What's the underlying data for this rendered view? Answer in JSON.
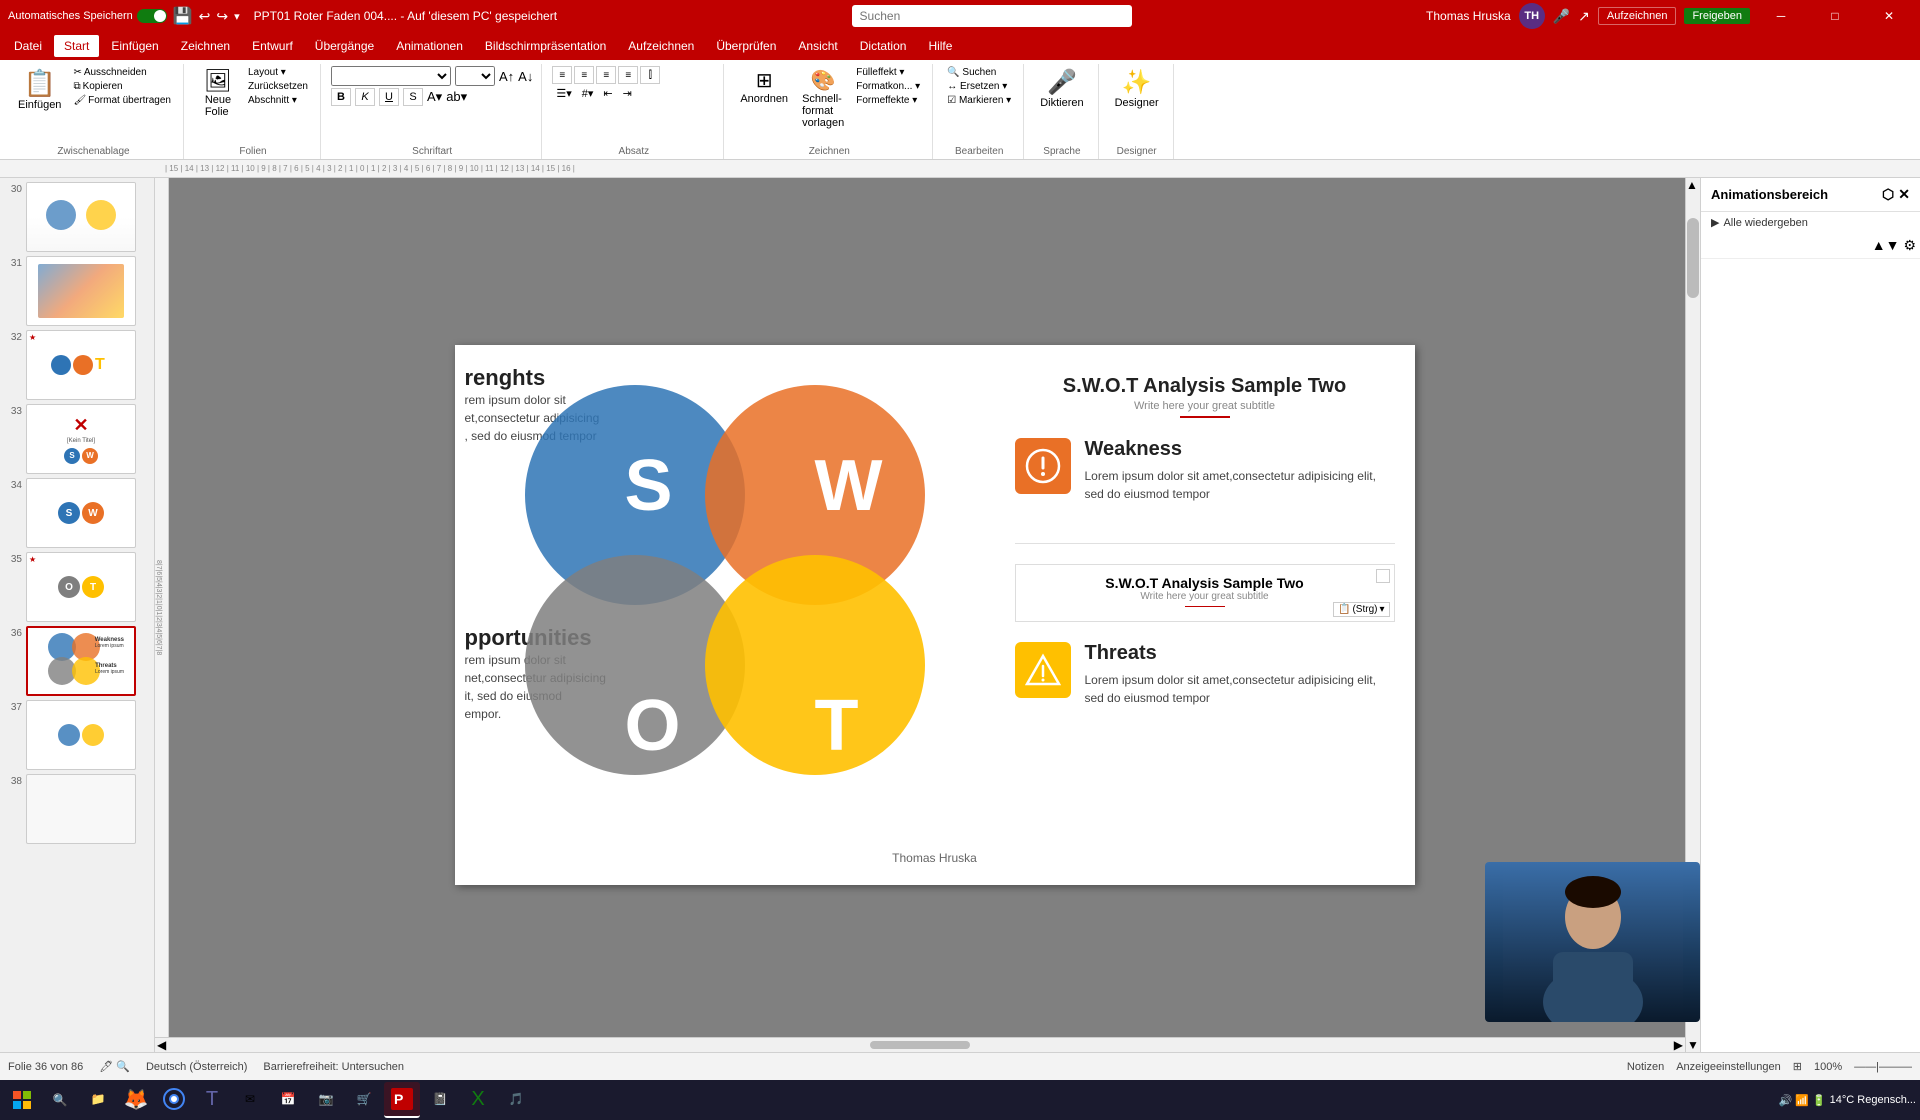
{
  "app": {
    "title": "PPT01 Roter Faden 004.... - Auf 'diesem PC' gespeichert",
    "user": "Thomas Hruska",
    "initials": "TH"
  },
  "titlebar": {
    "autosave_label": "Automatisches Speichern",
    "save_icon": "💾",
    "undo_icon": "↩",
    "redo_icon": "↪",
    "close": "✕",
    "minimize": "─",
    "maximize": "□",
    "search_placeholder": "Suchen",
    "record_btn": "Aufzeichnen",
    "share_btn": "Freigeben"
  },
  "menubar": {
    "items": [
      "Datei",
      "Start",
      "Einfügen",
      "Zeichnen",
      "Entwurf",
      "Übergänge",
      "Animationen",
      "Bildschirmpräsentation",
      "Aufzeichnen",
      "Überprüfen",
      "Ansicht",
      "Dictation",
      "Hilfe"
    ],
    "active": "Start"
  },
  "ribbon": {
    "groups": [
      {
        "label": "Zwischenablage",
        "items": [
          "Einfügen",
          "Ausschneiden",
          "Kopieren",
          "Format übertragen"
        ]
      },
      {
        "label": "Folien",
        "items": [
          "Neue Folie",
          "Layout",
          "Zurücksetzen",
          "Abschnitt"
        ]
      },
      {
        "label": "Schriftart",
        "items": [
          "B",
          "K",
          "U",
          "S",
          "Schriftgröße",
          "Farbe"
        ]
      },
      {
        "label": "Absatz",
        "items": [
          "Ausrichten",
          "Aufzählung",
          "Nummerierung"
        ]
      },
      {
        "label": "Zeichnen",
        "items": [
          "Anordnen",
          "Schnellformatvorlagen"
        ]
      },
      {
        "label": "Bearbeiten",
        "items": [
          "Suchen",
          "Ersetzen",
          "Markieren"
        ]
      },
      {
        "label": "Sprache",
        "items": [
          "Diktieren"
        ]
      },
      {
        "label": "Designer",
        "items": [
          "Designer"
        ]
      }
    ]
  },
  "slide_panel": {
    "slides": [
      {
        "num": 30,
        "active": false,
        "starred": false
      },
      {
        "num": 31,
        "active": false,
        "starred": false
      },
      {
        "num": 32,
        "active": false,
        "starred": true
      },
      {
        "num": 33,
        "active": false,
        "starred": false
      },
      {
        "num": 34,
        "active": false,
        "starred": false
      },
      {
        "num": 35,
        "active": false,
        "starred": true
      },
      {
        "num": 36,
        "active": true,
        "starred": false
      },
      {
        "num": 37,
        "active": false,
        "starred": false
      },
      {
        "num": 38,
        "active": false,
        "starred": false
      }
    ]
  },
  "slide": {
    "title": "S.W.O.T Analysis Sample Two",
    "subtitle": "Write here your great subtitle",
    "author": "Thomas Hruska",
    "weakness": {
      "heading": "Weakness",
      "text": "Lorem ipsum dolor sit amet,consectetur adipisicing elit, sed do eiusmod tempor"
    },
    "threats": {
      "heading": "Threats",
      "text": "Lorem ipsum dolor sit amet,consectetur adipisicing elit, sed do eiusmod tempor"
    },
    "strengths_text": "Lorem ipsum dolor sit amet,consectetur adipisicing , sed do eiusmod tempor",
    "opportunities_text": "Lorem ipsum dolor sit amet,consectetur adipisicing it, sed do eiusmod tempor.",
    "letters": {
      "s": "S",
      "w": "W",
      "o": "O",
      "t": "T"
    },
    "ctrl_label": "(Strg)"
  },
  "animation_panel": {
    "title": "Animationsbereich",
    "play_label": "Alle wiedergeben"
  },
  "statusbar": {
    "slide_info": "Folie 36 von 86",
    "language": "Deutsch (Österreich)",
    "accessibility": "Barrierefreiheit: Untersuchen",
    "notes": "Notizen",
    "view_settings": "Anzeigeeinstellungen"
  },
  "taskbar": {
    "time": "14°C  Regensch...",
    "apps": [
      "⊞",
      "📁",
      "🦊",
      "⬤",
      "💼",
      "✉",
      "🎵",
      "📸",
      "⬤",
      "⬤",
      "⬤",
      "⬤",
      "⬤"
    ]
  }
}
